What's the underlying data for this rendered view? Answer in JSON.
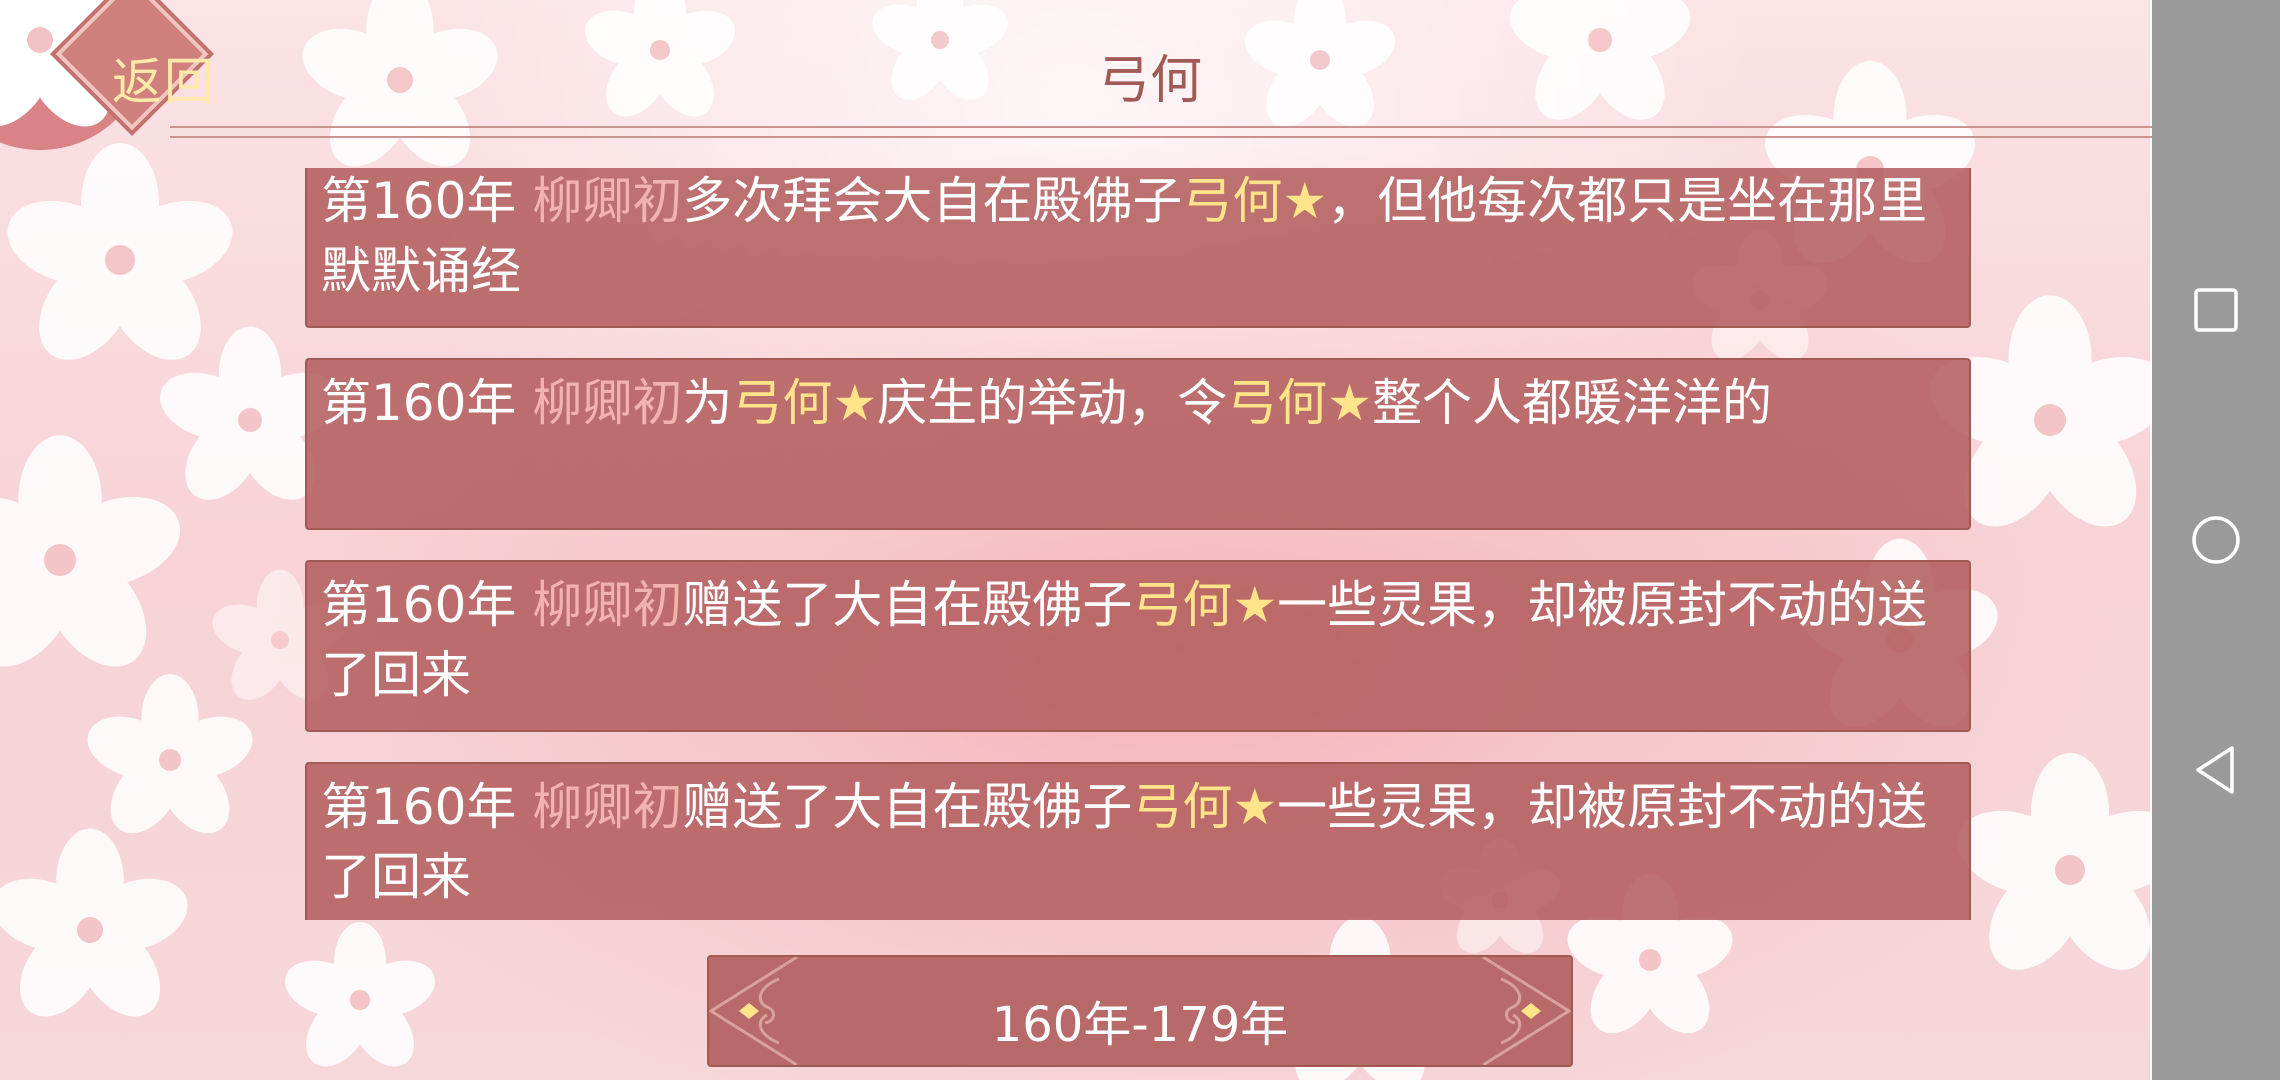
{
  "header": {
    "back_label": "返回",
    "title": "弓何"
  },
  "entries": [
    {
      "year": "第160年 ",
      "name": "柳卿初",
      "segments": [
        {
          "text": "多次拜会大自在殿佛子",
          "style": "plain"
        },
        {
          "text": "弓何★",
          "style": "buddha"
        },
        {
          "text": "，但他每次都只是坐在那里默默诵经",
          "style": "plain"
        }
      ]
    },
    {
      "year": "第160年 ",
      "name": "柳卿初",
      "segments": [
        {
          "text": "为",
          "style": "plain"
        },
        {
          "text": "弓何★",
          "style": "buddha"
        },
        {
          "text": "庆生的举动，令",
          "style": "plain"
        },
        {
          "text": "弓何★",
          "style": "buddha"
        },
        {
          "text": "整个人都暖洋洋的",
          "style": "plain"
        }
      ]
    },
    {
      "year": "第160年 ",
      "name": "柳卿初",
      "segments": [
        {
          "text": "赠送了大自在殿佛子",
          "style": "plain"
        },
        {
          "text": "弓何★",
          "style": "buddha"
        },
        {
          "text": "一些灵果，却被原封不动的送了回来",
          "style": "plain"
        }
      ]
    },
    {
      "year": "第160年 ",
      "name": "柳卿初",
      "segments": [
        {
          "text": "赠送了大自在殿佛子",
          "style": "plain"
        },
        {
          "text": "弓何★",
          "style": "buddha"
        },
        {
          "text": "一些灵果，却被原封不动的送了回来",
          "style": "plain"
        }
      ]
    }
  ],
  "pager": {
    "range_label": "160年-179年",
    "prev_icon": "ornate-left-arrow-icon",
    "next_icon": "ornate-right-arrow-icon"
  },
  "navbar": {
    "icons": [
      "recent-apps-icon",
      "home-icon",
      "back-icon"
    ]
  },
  "colors": {
    "entry_bg": "#b25c5c",
    "name_color": "#f2b2ad",
    "buddha_color": "#ffe489",
    "title_color": "#a25a55",
    "back_text": "#ffe9a8"
  }
}
